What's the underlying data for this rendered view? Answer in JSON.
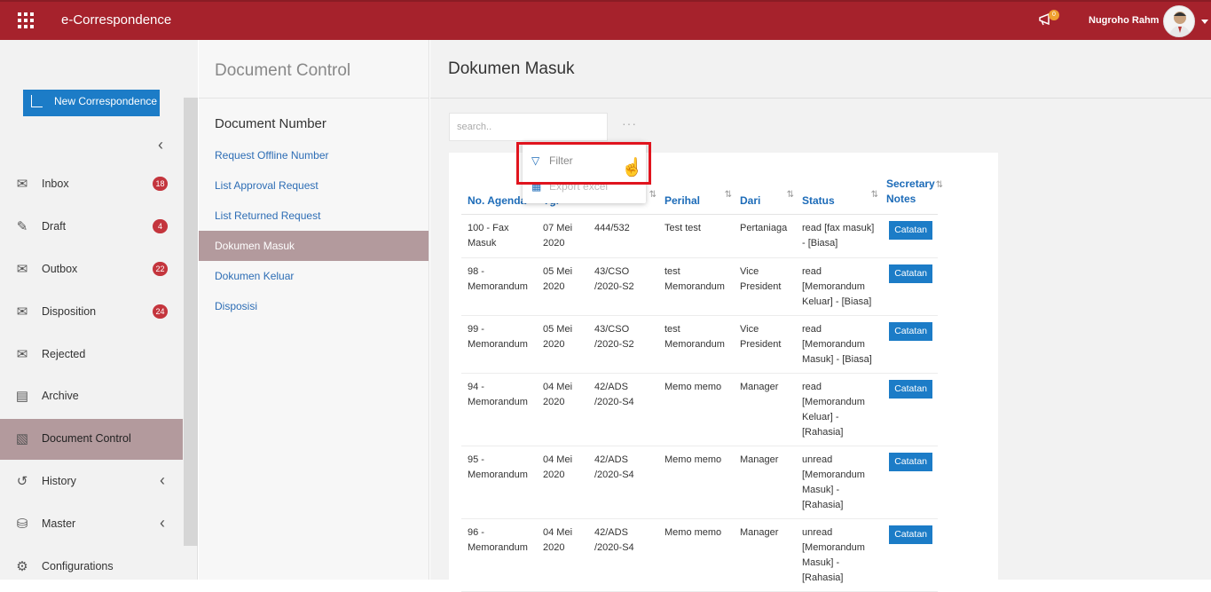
{
  "topbar": {
    "app_title": "e-Correspondence",
    "notif_count": "0",
    "user_name": "Nugroho Rahm"
  },
  "sidebar": {
    "new_button": "New Correspondence",
    "items": [
      {
        "label": "Inbox",
        "count": "18",
        "icon": "inbox-icon"
      },
      {
        "label": "Draft",
        "count": "4",
        "icon": "draft-icon"
      },
      {
        "label": "Outbox",
        "count": "22",
        "icon": "outbox-icon"
      },
      {
        "label": "Disposition",
        "count": "24",
        "icon": "disposition-icon"
      },
      {
        "label": "Rejected",
        "count": "",
        "icon": "rejected-icon"
      },
      {
        "label": "Archive",
        "count": "",
        "icon": "archive-icon"
      },
      {
        "label": "Document Control",
        "count": "",
        "icon": "document-control-icon"
      },
      {
        "label": "History",
        "count": "",
        "icon": "history-icon"
      },
      {
        "label": "Master",
        "count": "",
        "icon": "master-icon"
      },
      {
        "label": "Configurations",
        "count": "",
        "icon": "gear-icon"
      }
    ]
  },
  "panel": {
    "title": "Document Control",
    "section": "Document Number",
    "links": [
      "Request Offline Number",
      "List Approval Request",
      "List Returned Request",
      "Dokumen Masuk",
      "Dokumen Keluar",
      "Disposisi"
    ]
  },
  "main": {
    "title": "Dokumen Masuk",
    "search_placeholder": "search..",
    "more": "···",
    "menu": {
      "filter": "Filter",
      "export": "Export excel"
    },
    "columns": [
      "No. Agenda",
      "Tgl",
      "",
      "Perihal",
      "Dari",
      "Status",
      "Secretary Notes",
      ""
    ],
    "action_label": "Catatan",
    "rows": [
      {
        "agenda": "100 - Fax Masuk",
        "tgl": "07 Mei 2020",
        "no": "444/532",
        "perihal": "Test test",
        "dari": "Pertaniaga",
        "status": "read [fax masuk] - [Biasa]"
      },
      {
        "agenda": "98 - Memorandum",
        "tgl": "05 Mei 2020",
        "no": "43/CSO /2020-S2",
        "perihal": "test Memorandum",
        "dari": "Vice President",
        "status": "read [Memorandum Keluar] - [Biasa]"
      },
      {
        "agenda": "99 - Memorandum",
        "tgl": "05 Mei 2020",
        "no": "43/CSO /2020-S2",
        "perihal": "test Memorandum",
        "dari": "Vice President",
        "status": "read [Memorandum Masuk] - [Biasa]"
      },
      {
        "agenda": "94 - Memorandum",
        "tgl": "04 Mei 2020",
        "no": "42/ADS /2020-S4",
        "perihal": "Memo memo",
        "dari": "Manager",
        "status": "read [Memorandum Keluar] - [Rahasia]"
      },
      {
        "agenda": "95 - Memorandum",
        "tgl": "04 Mei 2020",
        "no": "42/ADS /2020-S4",
        "perihal": "Memo memo",
        "dari": "Manager",
        "status": "unread [Memorandum Masuk] - [Rahasia]"
      },
      {
        "agenda": "96 - Memorandum",
        "tgl": "04 Mei 2020",
        "no": "42/ADS /2020-S4",
        "perihal": "Memo memo",
        "dari": "Manager",
        "status": "unread [Memorandum Masuk] - [Rahasia]"
      }
    ]
  }
}
